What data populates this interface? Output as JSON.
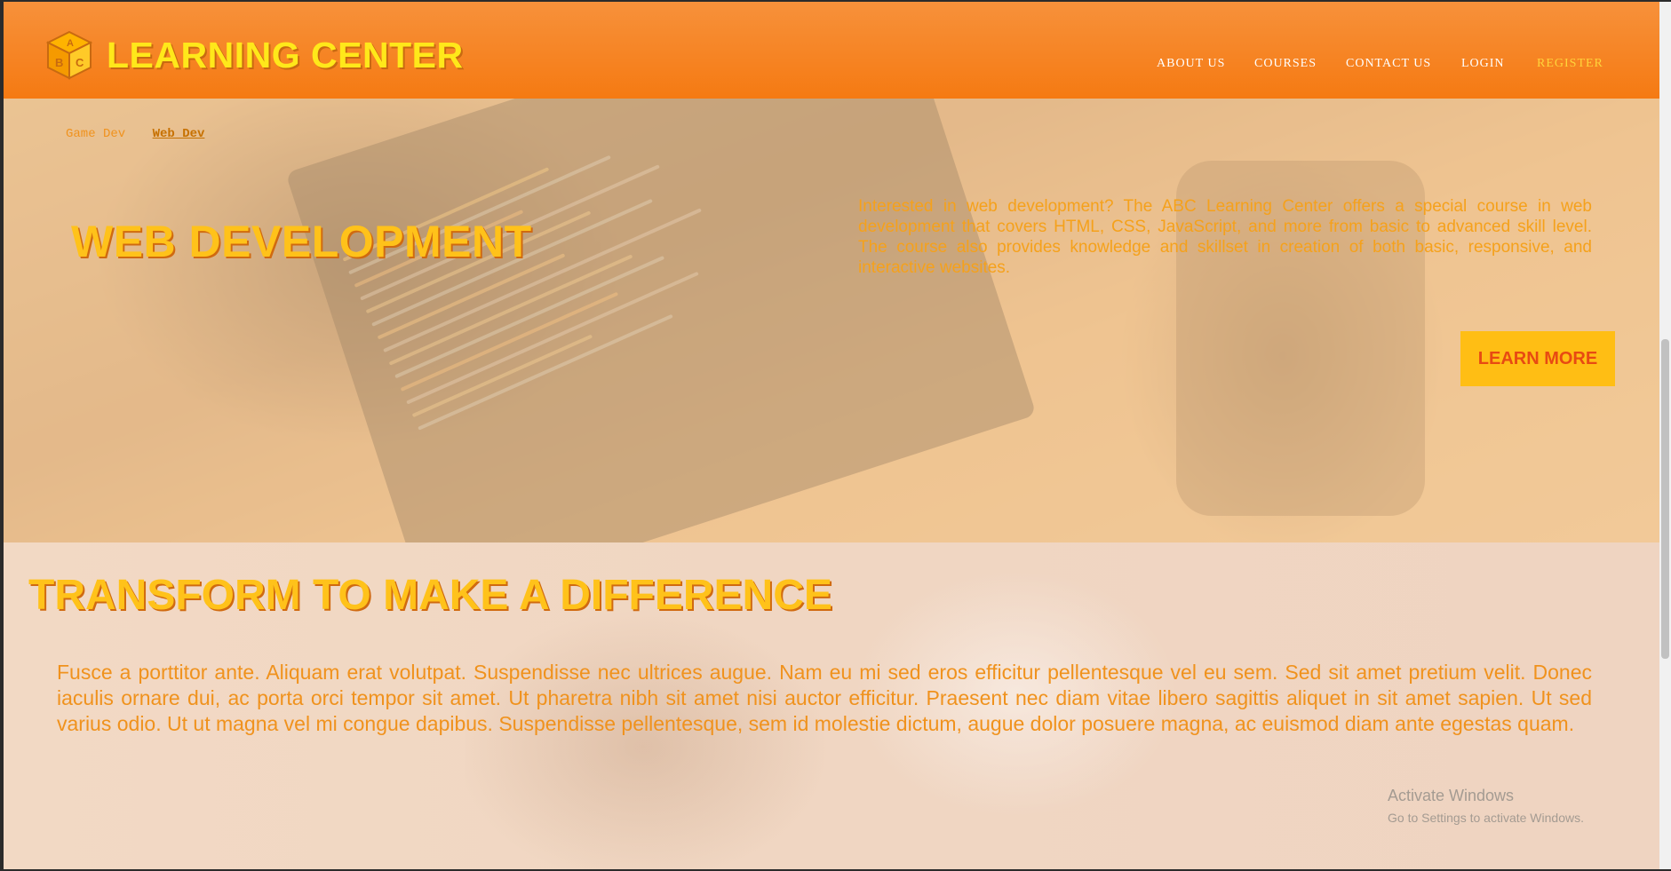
{
  "header": {
    "brand": "LEARNING CENTER",
    "logo_letters": [
      "A",
      "B",
      "C"
    ],
    "nav": [
      {
        "label": "ABOUT US",
        "active": false
      },
      {
        "label": "COURSES",
        "active": false
      },
      {
        "label": "CONTACT US",
        "active": false
      },
      {
        "label": "LOGIN",
        "active": false
      },
      {
        "label": "REGISTER",
        "active": true
      }
    ]
  },
  "hero": {
    "breadcrumbs": [
      {
        "label": "Game Dev",
        "active": false
      },
      {
        "label": "Web Dev",
        "active": true
      }
    ],
    "title": "WEB DEVELOPMENT",
    "description": "Interested in web development? The ABC Learning Center offers a special course in web development that covers HTML, CSS, JavaScript, and more from basic to advanced skill level. The course also provides knowledge and skillset in creation of both basic, responsive, and interactive websites.",
    "button_label": "LEARN MORE"
  },
  "section": {
    "title": "TRANSFORM TO MAKE A DIFFERENCE",
    "text": "Fusce a porttitor ante. Aliquam erat volutpat. Suspendisse nec ultrices augue. Nam eu mi sed eros efficitur pellentesque vel eu sem. Sed sit amet pretium velit. Donec iaculis ornare dui, ac porta orci tempor sit amet. Ut pharetra nibh sit amet nisi auctor efficitur. Praesent nec diam vitae libero sagittis aliquet in sit amet sapien. Ut sed varius odio. Ut ut magna vel mi congue dapibus. Suspendisse pellentesque, sem id molestie dictum, augue dolor posuere magna, ac euismod diam ante egestas quam."
  },
  "watermark": {
    "line1": "Activate Windows",
    "line2": "Go to Settings to activate Windows."
  },
  "colors": {
    "header": "#f57a12",
    "brand": "#ffe81a",
    "accent": "#ffc21a",
    "button_bg": "#ffbe14",
    "button_text": "#e84a12",
    "body_text": "#f0921d"
  }
}
